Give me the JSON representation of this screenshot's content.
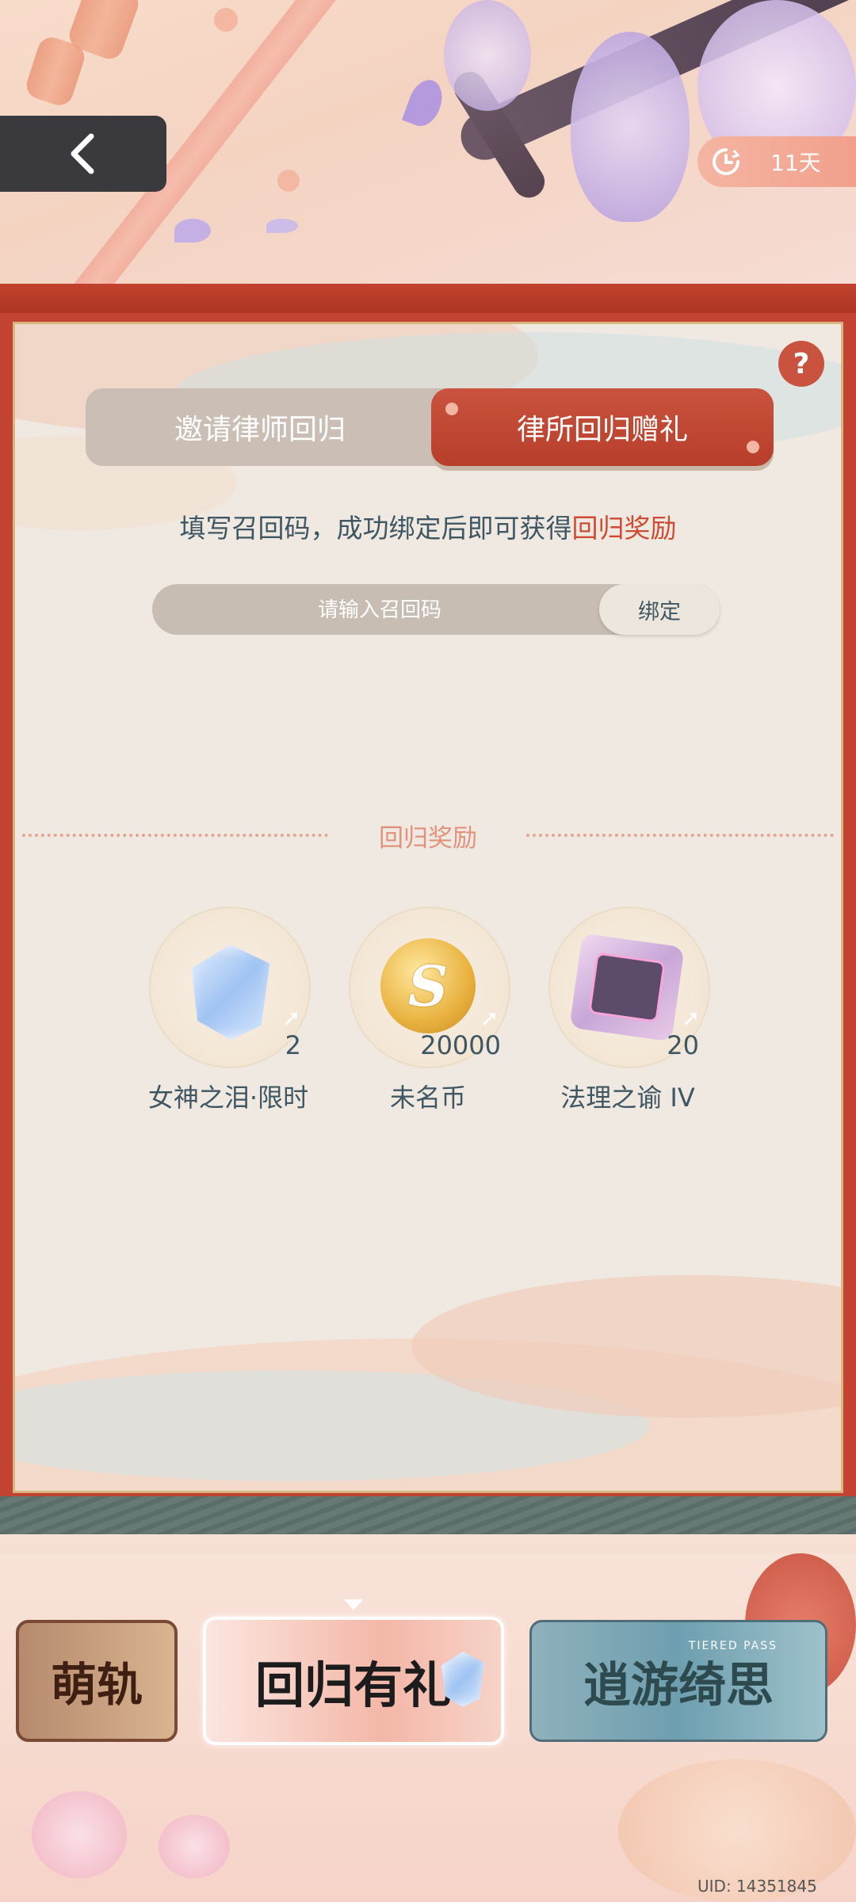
{
  "header": {
    "back_icon": "chevron-left-icon",
    "timer_icon": "clock-refresh-icon",
    "timer_text": "11天"
  },
  "panel": {
    "help_label": "?",
    "tabs": [
      {
        "label": "邀请律师回归",
        "active": false
      },
      {
        "label": "律所回归赠礼",
        "active": true
      }
    ],
    "description_prefix": "填写召回码，成功绑定后即可获得",
    "description_highlight": "回归奖励",
    "code_input": {
      "placeholder": "请输入召回码",
      "value": ""
    },
    "bind_label": "绑定",
    "section_title": "回归奖励",
    "rewards": [
      {
        "name": "女神之泪·限时",
        "qty": "2",
        "icon": "gem-icon"
      },
      {
        "name": "未名币",
        "qty": "20000",
        "icon": "coin-icon"
      },
      {
        "name": "法理之谕 IV",
        "qty": "20",
        "icon": "chip-card-icon"
      }
    ]
  },
  "carousel": {
    "banners": [
      {
        "label": "萌轨",
        "selected": false
      },
      {
        "label": "回归有礼",
        "selected": true
      },
      {
        "label": "逍游绮思",
        "sub": "TIERED PASS",
        "selected": false
      }
    ]
  },
  "footer": {
    "uid": "UID: 14351845"
  },
  "colors": {
    "accent_red": "#c24331",
    "highlight_text": "#d04b33",
    "text_dark": "#3f5663"
  }
}
